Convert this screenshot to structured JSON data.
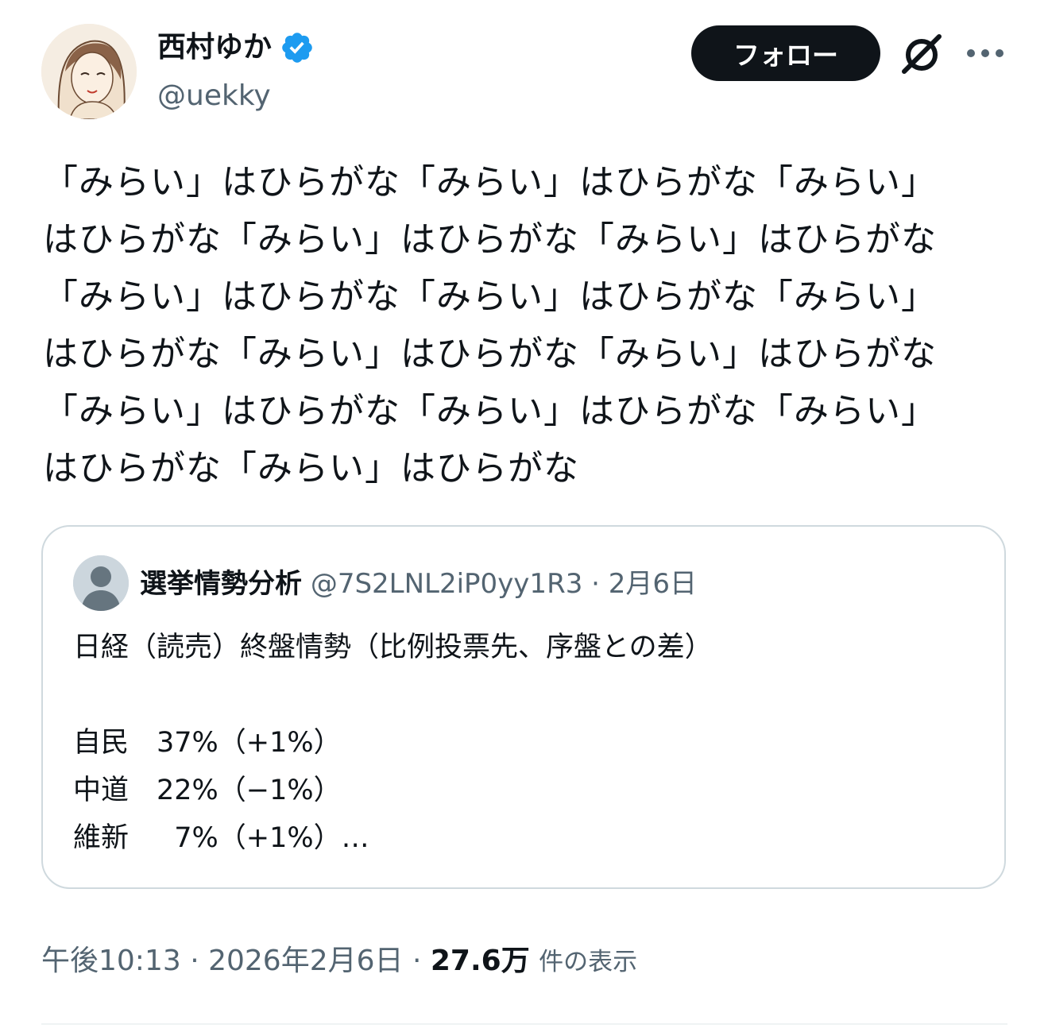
{
  "author": {
    "display_name": "西村ゆか",
    "handle": "@uekky",
    "verified": true,
    "avatar_icon": "illustrated-portrait-avatar"
  },
  "actions": {
    "follow_label": "フォロー",
    "grok_icon": "grok-slash-icon",
    "more_icon": "more-dots-icon"
  },
  "tweet": {
    "text": "「みらい」はひらがな「みらい」はひらがな「みらい」\nはひらがな「みらい」はひらがな「みらい」はひらがな\n「みらい」はひらがな「みらい」はひらがな「みらい」\nはひらがな「みらい」はひらがな「みらい」はひらがな\n「みらい」はひらがな「みらい」はひらがな「みらい」\nはひらがな「みらい」はひらがな"
  },
  "quote": {
    "display_name": "選挙情勢分析",
    "handle": "@7S2LNL2iP0yy1R3",
    "separator": " · ",
    "date": "2月6日",
    "avatar_icon": "default-user-avatar",
    "body": "日経（読売）終盤情勢（比例投票先、序盤との差）\n\n自民　37%（+1%）\n中道　22%（−1%）\n維新　  7%（+1%）…"
  },
  "footer": {
    "time": "午後10:13",
    "separator": " · ",
    "date": "2026年2月6日",
    "views_count": "27.6万",
    "views_label": "件の表示"
  },
  "colors": {
    "text_primary": "#0f1419",
    "text_secondary": "#536471",
    "verified_blue": "#1d9bf0",
    "border": "#cfd9de"
  }
}
